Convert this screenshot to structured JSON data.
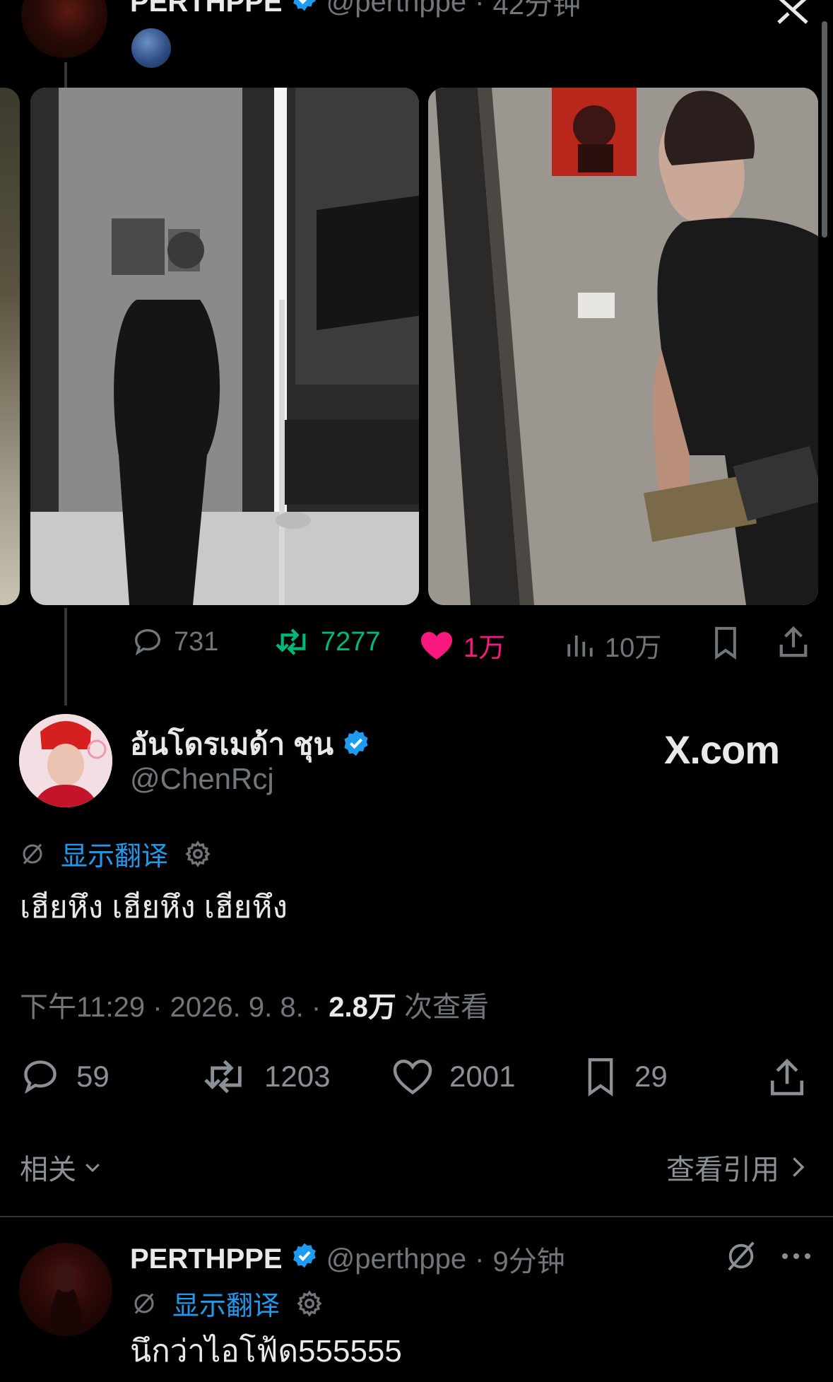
{
  "top_tweet": {
    "name": "PERTHPPE",
    "handle": "@perthppe",
    "time": "42分钟",
    "metrics": {
      "replies": "731",
      "retweets": "7277",
      "likes": "1万",
      "views": "10万"
    }
  },
  "main_tweet": {
    "name": "อันโดรเมด้า ชุน",
    "handle": "@ChenRcj",
    "watermark": "X.com",
    "translate_label": "显示翻译",
    "text": "เฮียหึง เฮียหึง เฮียหึง",
    "timestamp": "下午11:29 · 2026. 9. 8. ·",
    "views_count": "2.8万",
    "views_suffix": "次查看",
    "metrics": {
      "replies": "59",
      "retweets": "1203",
      "likes": "2001",
      "bookmarks": "29"
    },
    "related_label": "相关",
    "quotes_label": "查看引用"
  },
  "reply": {
    "name": "PERTHPPE",
    "handle": "@perthppe",
    "time": "9分钟",
    "translate_label": "显示翻译",
    "text": "นึกว่าไอโฟ้ด555555"
  },
  "colors": {
    "background": "#000000",
    "accent_blue": "#1d9bf0",
    "retweet_green": "#00ba7c",
    "like_pink": "#f91880",
    "muted": "#71767b"
  }
}
